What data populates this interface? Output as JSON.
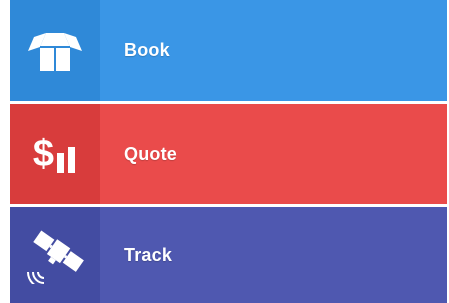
{
  "menu": {
    "items": [
      {
        "label": "Book",
        "icon": "open-box-icon",
        "color": "#3a96e6"
      },
      {
        "label": "Quote",
        "icon": "price-chart-icon",
        "icon_text": "$",
        "color": "#ea4b4b"
      },
      {
        "label": "Track",
        "icon": "satellite-icon",
        "color": "#4f58b0"
      }
    ]
  }
}
